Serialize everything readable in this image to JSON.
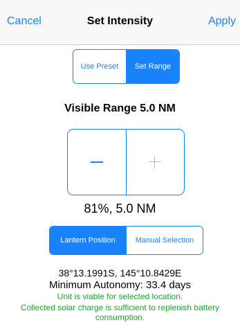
{
  "nav": {
    "cancel": "Cancel",
    "title": "Set Intensity",
    "apply": "Apply"
  },
  "mode_segment": {
    "options": [
      "Use Preset",
      "Set Range"
    ],
    "selected": "Set Range"
  },
  "visible_range": "Visible Range  5.0 NM",
  "stepper": {
    "minus_icon": "minus-icon",
    "plus_icon": "plus-icon"
  },
  "current_value": "81%, 5.0 NM",
  "position_segment": {
    "options": [
      "Lantern Position",
      "Manual Selection"
    ],
    "selected": "Lantern Position"
  },
  "info": {
    "coordinates": "38°13.1991S, 145°10.8429E",
    "autonomy": "Minimum Autonomy: 33.4 days",
    "viable": "Unit is viable for selected location.",
    "solar": "Collected solar charge is sufficient to replenish battery consumption."
  },
  "colors": {
    "accent": "#1a82fb",
    "status_ok": "#1aa32a"
  }
}
